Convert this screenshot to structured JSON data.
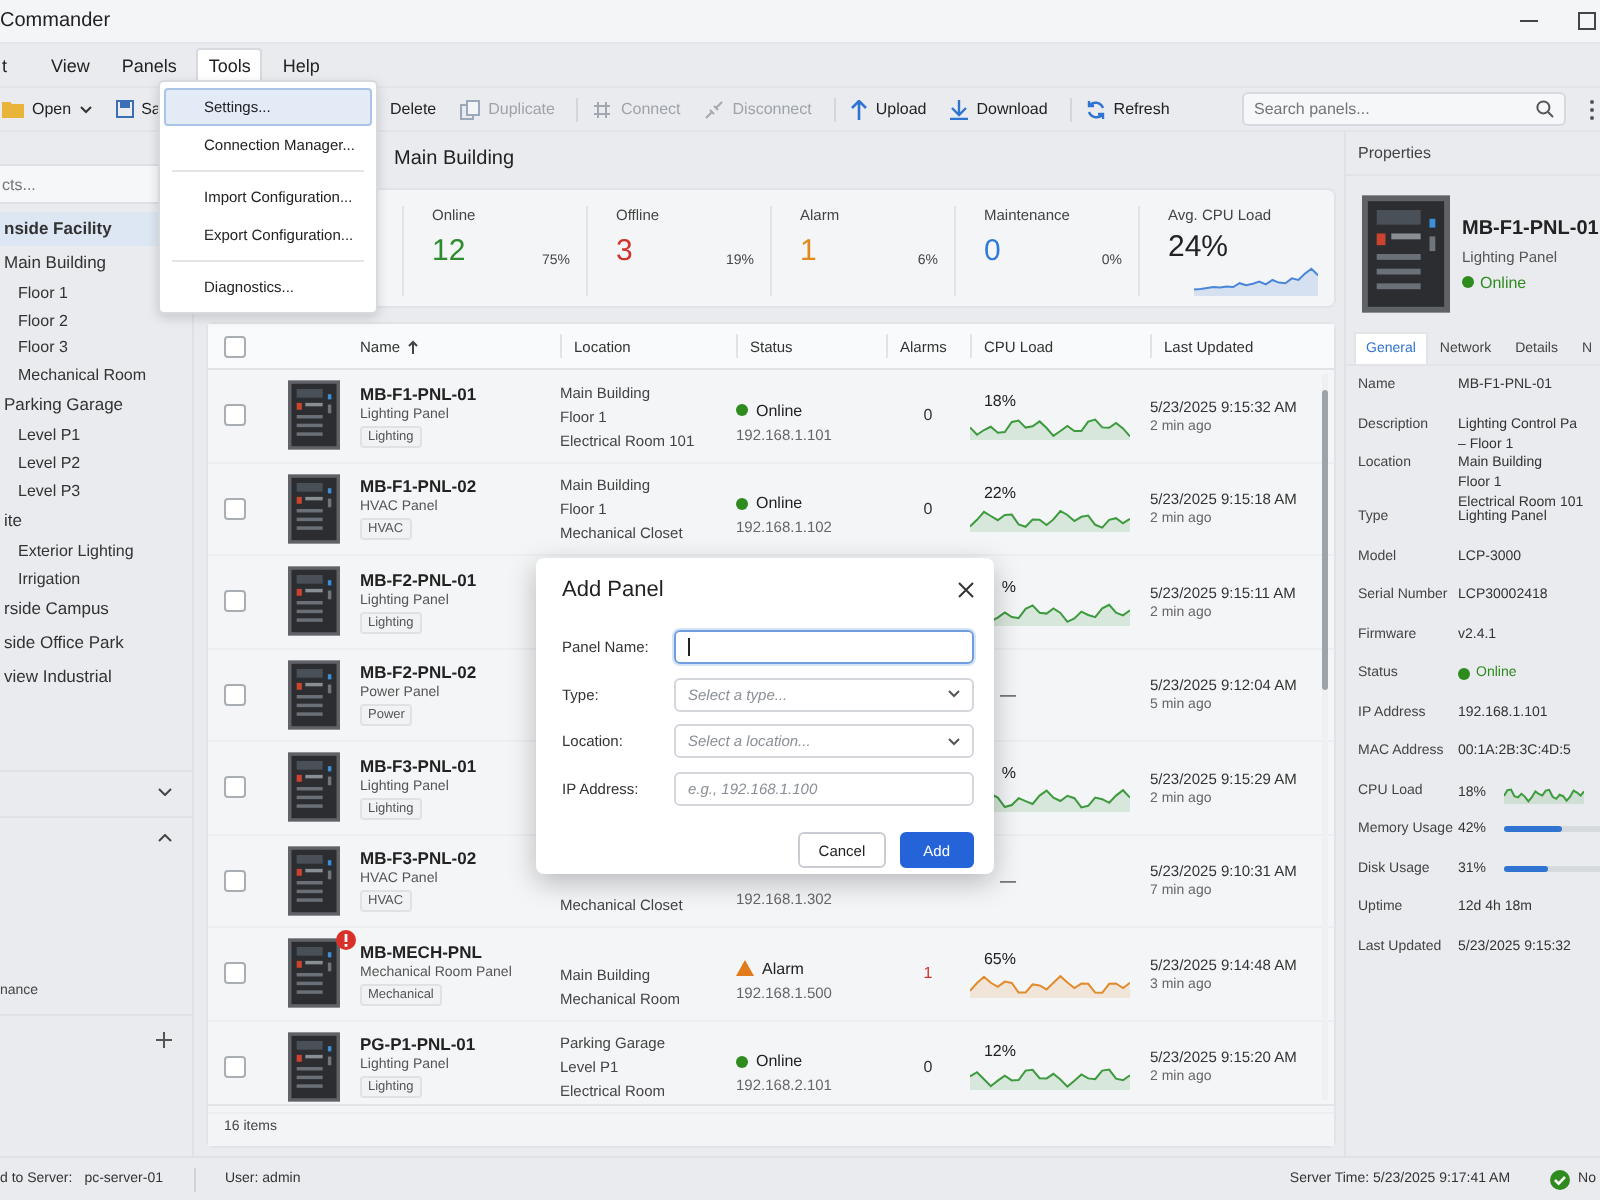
{
  "window": {
    "title": "Commander"
  },
  "menu": [
    {
      "label": "t",
      "open": false
    },
    {
      "label": "View",
      "open": false
    },
    {
      "label": "Panels",
      "open": false
    },
    {
      "label": "Tools",
      "open": true
    },
    {
      "label": "Help",
      "open": false
    }
  ],
  "tools_menu": [
    [
      {
        "label": "Settings...",
        "selected": true
      },
      {
        "label": "Connection Manager...",
        "selected": false
      }
    ],
    [
      {
        "label": "Import Configuration...",
        "selected": false
      },
      {
        "label": "Export Configuration...",
        "selected": false
      }
    ],
    [
      {
        "label": "Diagnostics...",
        "selected": false
      }
    ]
  ],
  "toolbar": [
    [
      {
        "kind": "open",
        "label": "Open",
        "dropdown": true,
        "disabled": false
      },
      {
        "kind": "save",
        "label": "Sa",
        "dropdown": false,
        "disabled": false
      }
    ],
    [
      {
        "kind": "plain",
        "label": "Delete",
        "dropdown": false,
        "disabled": false
      },
      {
        "kind": "duplicate",
        "label": "Duplicate",
        "dropdown": false,
        "disabled": true
      }
    ],
    [
      {
        "kind": "connect",
        "label": "Connect",
        "dropdown": false,
        "disabled": true
      },
      {
        "kind": "disconnect",
        "label": "Disconnect",
        "dropdown": false,
        "disabled": true
      }
    ],
    [
      {
        "kind": "upload",
        "label": "Upload",
        "dropdown": false,
        "disabled": false
      },
      {
        "kind": "download",
        "label": "Download",
        "dropdown": false,
        "disabled": false
      }
    ],
    [
      {
        "kind": "refresh",
        "label": "Refresh",
        "dropdown": false,
        "disabled": false
      }
    ]
  ],
  "search": {
    "placeholder": "Search panels..."
  },
  "sidebar": {
    "search": {
      "placeholder": "cts..."
    },
    "tree": [
      {
        "label": "nside Facility",
        "selected": true,
        "children": [
          {
            "label": "Main Building",
            "selected": false,
            "children": [
              {
                "label": "Floor 1",
                "selected": false
              },
              {
                "label": "Floor 2",
                "selected": false
              },
              {
                "label": "Floor 3",
                "selected": false
              },
              {
                "label": "Mechanical Room",
                "selected": false
              }
            ]
          },
          {
            "label": "Parking Garage",
            "selected": false,
            "children": [
              {
                "label": "Level P1",
                "selected": false
              },
              {
                "label": "Level P2",
                "selected": false
              },
              {
                "label": "Level P3",
                "selected": false
              }
            ]
          },
          {
            "label": "ite",
            "selected": false,
            "children": [
              {
                "label": "Exterior Lighting",
                "selected": false
              },
              {
                "label": "Irrigation",
                "selected": false
              }
            ]
          }
        ]
      },
      {
        "label": "rside Campus",
        "selected": false
      },
      {
        "label": "side Office Park",
        "selected": false
      },
      {
        "label": "view Industrial",
        "selected": false
      }
    ],
    "sections": [
      {
        "kind": "collapsible",
        "expanded": false
      },
      {
        "kind": "collapsible",
        "expanded": true,
        "text": "nance"
      },
      {
        "kind": "add"
      }
    ]
  },
  "content": {
    "title": "Main Building",
    "stats": [
      {
        "label": "Online",
        "value": "12",
        "percent": "75%",
        "color": "#2e8b2e"
      },
      {
        "label": "Offline",
        "value": "3",
        "percent": "19%",
        "color": "#d0342c"
      },
      {
        "label": "Alarm",
        "value": "1",
        "percent": "6%",
        "color": "#e08a1e"
      },
      {
        "label": "Maintenance",
        "value": "0",
        "percent": "0%",
        "color": "#2f7bd6"
      },
      {
        "label": "Avg. CPU Load",
        "value": "24%",
        "kind": "trend"
      }
    ],
    "table": {
      "select_all": false,
      "columns": [
        {
          "label": "Name",
          "sorted": true
        },
        {
          "label": "Location",
          "sorted": false
        },
        {
          "label": "Status",
          "sorted": false
        },
        {
          "label": "Alarms",
          "sorted": false
        },
        {
          "label": "CPU Load",
          "sorted": false
        },
        {
          "label": "Last Updated",
          "sorted": false
        }
      ],
      "rows": [
        {
          "checked": false,
          "alert": false,
          "name": "MB-F1-PNL-01",
          "type": "Lighting Panel",
          "tag": "Lighting",
          "location": [
            "Main Building",
            "Floor 1",
            "Electrical Room 101"
          ],
          "status": {
            "kind": "online",
            "label": "Online",
            "ip": "192.168.1.101"
          },
          "alarms": {
            "count": "0",
            "critical": false
          },
          "cpu": {
            "text": "18%",
            "kind": "normal"
          },
          "updated": {
            "time": "5/23/2025 9:15:32 AM",
            "ago": "2 min ago"
          }
        },
        {
          "checked": false,
          "alert": false,
          "name": "MB-F1-PNL-02",
          "type": "HVAC Panel",
          "tag": "HVAC",
          "location": [
            "Main Building",
            "Floor 1",
            "Mechanical Closet"
          ],
          "status": {
            "kind": "online",
            "label": "Online",
            "ip": "192.168.1.102"
          },
          "alarms": {
            "count": "0",
            "critical": false
          },
          "cpu": {
            "text": "22%",
            "kind": "normal"
          },
          "updated": {
            "time": "5/23/2025 9:15:18 AM",
            "ago": "2 min ago"
          }
        },
        {
          "checked": false,
          "alert": false,
          "name": "MB-F2-PNL-01",
          "type": "Lighting Panel",
          "tag": "Lighting",
          "cpu": {
            "text": "%",
            "kind": "normal"
          },
          "updated": {
            "time": "5/23/2025 9:15:11 AM",
            "ago": "2 min ago"
          }
        },
        {
          "checked": false,
          "alert": false,
          "name": "MB-F2-PNL-02",
          "type": "Power Panel",
          "tag": "Power",
          "cpu": {
            "text": "—"
          },
          "updated": {
            "time": "5/23/2025 9:12:04 AM",
            "ago": "5 min ago"
          }
        },
        {
          "checked": false,
          "alert": false,
          "name": "MB-F3-PNL-01",
          "type": "Lighting Panel",
          "tag": "Lighting",
          "cpu": {
            "text": "%",
            "kind": "normal"
          },
          "updated": {
            "time": "5/23/2025 9:15:29 AM",
            "ago": "2 min ago"
          }
        },
        {
          "checked": false,
          "alert": false,
          "name": "MB-F3-PNL-02",
          "type": "HVAC Panel",
          "tag": "HVAC",
          "location": [
            "Mechanical Closet"
          ],
          "status": {
            "ip": "192.168.1.302"
          },
          "cpu": {
            "text": "—"
          },
          "updated": {
            "time": "5/23/2025 9:10:31 AM",
            "ago": "7 min ago"
          }
        },
        {
          "checked": false,
          "alert": true,
          "name": "MB-MECH-PNL",
          "type": "Mechanical Room Panel",
          "tag": "Mechanical",
          "location": [
            "Main Building",
            "Mechanical Room"
          ],
          "status": {
            "kind": "alarm",
            "label": "Alarm",
            "ip": "192.168.1.500"
          },
          "alarms": {
            "count": "1",
            "critical": true
          },
          "cpu": {
            "text": "65%",
            "kind": "high"
          },
          "updated": {
            "time": "5/23/2025 9:14:48 AM",
            "ago": "3 min ago"
          }
        },
        {
          "checked": false,
          "alert": false,
          "name": "PG-P1-PNL-01",
          "type": "Lighting Panel",
          "tag": "Lighting",
          "location": [
            "Parking Garage",
            "Level P1",
            "Electrical Room"
          ],
          "status": {
            "kind": "online",
            "label": "Online",
            "ip": "192.168.2.101"
          },
          "alarms": {
            "count": "0",
            "critical": false
          },
          "cpu": {
            "text": "12%",
            "kind": "normal"
          },
          "updated": {
            "time": "5/23/2025 9:15:20 AM",
            "ago": "2 min ago"
          }
        }
      ],
      "footer": "16 items"
    }
  },
  "properties": {
    "title": "Properties",
    "name": "MB-F1-PNL-01",
    "type": "Lighting Panel",
    "status": {
      "kind": "online",
      "label": "Online"
    },
    "tabs": [
      {
        "label": "General",
        "selected": true
      },
      {
        "label": "Network",
        "selected": false
      },
      {
        "label": "Details",
        "selected": false
      },
      {
        "label": "N",
        "selected": false
      }
    ],
    "fields": [
      {
        "kind": "text",
        "label": "Name",
        "lines": [
          "MB-F1-PNL-01"
        ]
      },
      {
        "kind": "text",
        "label": "Description",
        "lines": [
          "Lighting Control Pa",
          "– Floor 1"
        ]
      },
      {
        "kind": "text",
        "label": "Location",
        "lines": [
          "Main Building",
          "Floor 1",
          "Electrical Room 101"
        ]
      },
      {
        "kind": "text",
        "label": "Type",
        "lines": [
          "Lighting Panel"
        ]
      },
      {
        "kind": "text",
        "label": "Model",
        "lines": [
          "LCP-3000"
        ]
      },
      {
        "kind": "text",
        "label": "Serial Number",
        "lines": [
          "LCP30002418"
        ]
      },
      {
        "kind": "text",
        "label": "Firmware",
        "lines": [
          "v2.4.1"
        ]
      },
      {
        "kind": "status",
        "label": "Status",
        "value": "Online",
        "ok": true
      },
      {
        "kind": "text",
        "label": "IP Address",
        "lines": [
          "192.168.1.101"
        ]
      },
      {
        "kind": "text",
        "label": "MAC Address",
        "lines": [
          "00:1A:2B:3C:4D:5"
        ]
      },
      {
        "kind": "trend",
        "label": "CPU Load",
        "value": "18%"
      },
      {
        "kind": "bar",
        "label": "Memory Usage",
        "value": "42%",
        "level": 0.42
      },
      {
        "kind": "bar",
        "label": "Disk Usage",
        "value": "31%",
        "level": 0.31
      },
      {
        "kind": "text",
        "label": "Uptime",
        "lines": [
          "12d 4h 18m"
        ]
      },
      {
        "kind": "text",
        "label": "Last Updated",
        "lines": [
          "5/23/2025 9:15:32"
        ]
      }
    ]
  },
  "status_bar": {
    "server_label": "d to Server:",
    "server": "pc-server-01",
    "user": "User: admin",
    "time": "Server Time: 5/23/2025 9:17:41 AM",
    "connection": {
      "ok": true,
      "label": "No"
    }
  },
  "dialog": {
    "title": "Add Panel",
    "fields": [
      {
        "label": "Panel Name:",
        "kind": "text",
        "focused": true
      },
      {
        "label": "Type:",
        "kind": "select",
        "placeholder": "Select a type...",
        "focused": false
      },
      {
        "label": "Location:",
        "kind": "select",
        "placeholder": "Select a location...",
        "focused": false
      },
      {
        "label": "IP Address:",
        "kind": "text",
        "placeholder": "e.g., 192.168.1.100",
        "focused": false
      }
    ],
    "buttons": [
      {
        "label": "Cancel",
        "primary": false
      },
      {
        "label": "Add",
        "primary": true
      }
    ]
  }
}
